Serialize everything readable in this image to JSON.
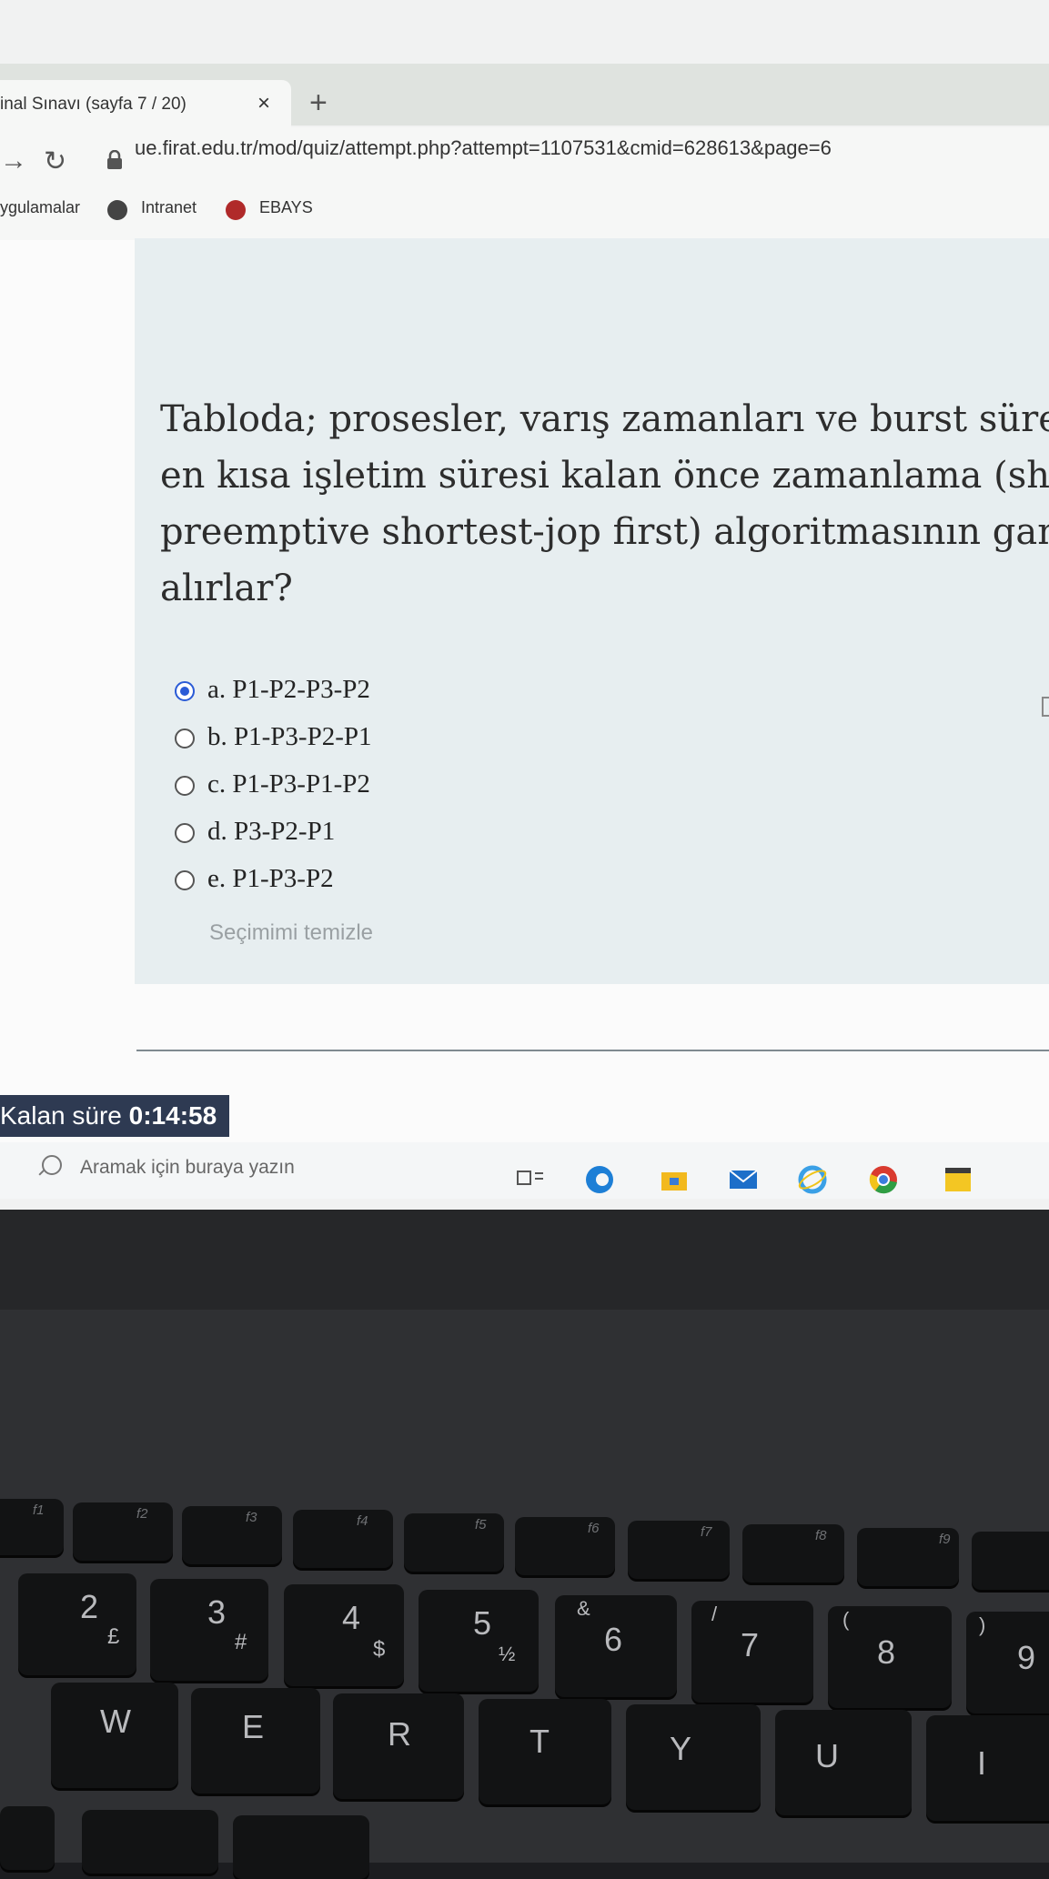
{
  "browser": {
    "tab_title": "inal Sınavı (sayfa 7 / 20)",
    "tab_close": "×",
    "new_tab": "+",
    "url": "ue.firat.edu.tr/mod/quiz/attempt.php?attempt=1107531&cmid=628613&page=6",
    "bookmarks": [
      "ygulamalar",
      "Intranet",
      "EBAYS"
    ]
  },
  "question": {
    "lines": [
      "Tabloda; prosesler, varış zamanları ve burst süreleri v",
      "en kısa işletim süresi kalan önce zamanlama (short re",
      "preemptive shortest-jop first) algoritmasının gantt şe",
      "alırlar?"
    ],
    "options": [
      {
        "label": "a. P1-P2-P3-P2",
        "selected": true
      },
      {
        "label": "b. P1-P3-P2-P1",
        "selected": false
      },
      {
        "label": "c. P1-P3-P1-P2",
        "selected": false
      },
      {
        "label": "d. P3-P2-P1",
        "selected": false
      },
      {
        "label": "e. P1-P3-P2",
        "selected": false
      }
    ],
    "clear_choice": "Seçimimi temizle"
  },
  "timer": {
    "label": "Kalan süre",
    "value": "0:14:58"
  },
  "taskbar": {
    "search_placeholder": "Aramak için buraya yazın",
    "icons": [
      "task-view-icon",
      "edge-icon",
      "file-explorer-icon",
      "mail-icon",
      "internet-explorer-icon",
      "chrome-icon",
      "sticky-notes-icon"
    ]
  },
  "keyboard": {
    "function_keys": [
      "f1",
      "f2",
      "f3",
      "f4",
      "f5",
      "f6",
      "f7",
      "f8",
      "f9"
    ],
    "number_row": [
      "2",
      "3",
      "4",
      "5",
      "6",
      "7",
      "8",
      "9"
    ],
    "number_row_shift": [
      "£",
      "#",
      "$",
      "½",
      "&",
      "/",
      "(",
      ")"
    ],
    "letter_row": [
      "W",
      "E",
      "R",
      "T",
      "Y",
      "U",
      "I"
    ]
  }
}
